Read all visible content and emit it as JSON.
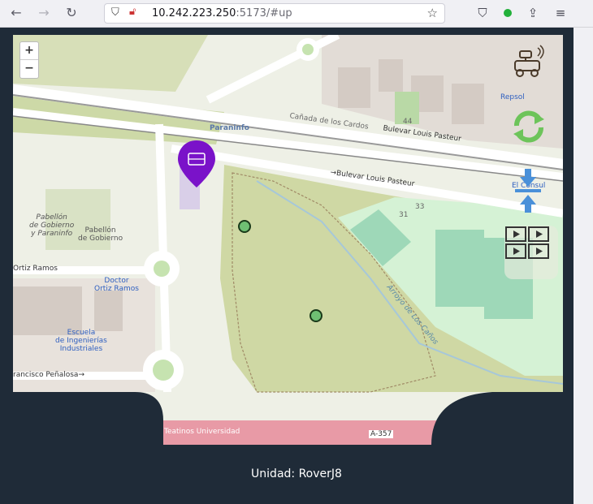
{
  "browser": {
    "url_host": "10.242.223.250",
    "url_path": ":5173/#up"
  },
  "map": {
    "labels": {
      "paraninfo": "Paraninfo",
      "canada": "Cañada de los Cardos",
      "bulevar1": "Bulevar Louis Pasteur",
      "bulevar2": "→Bulevar Louis Pasteur",
      "pabellon1": "Pabellón\nde Gobierno\ny Paraninfo",
      "pabellon2": "Pabellón\nde Gobierno",
      "ortiz": "Ortiz Ramos",
      "doctor": "Doctor\nOrtiz Ramos",
      "escuela": "Escuela\nde Ingenierías\nIndustriales",
      "francisco": "rancisco Peñalosa→",
      "teatinos": "Teatinos Universidad",
      "a357": "A-357",
      "repsol": "Repsol",
      "elconsul": "El Consul",
      "arroyo": "Arroyo de Los Caños",
      "num44": "44",
      "num31": "31",
      "num33": "33"
    },
    "zoom_in": "+",
    "zoom_out": "−"
  },
  "tools": {
    "rover": "rover-icon",
    "refresh": "refresh-icon",
    "center": "center-arrows-icon",
    "video": "video-grid-icon"
  },
  "footer": {
    "unit_text": "Unidad: RoverJ8"
  }
}
